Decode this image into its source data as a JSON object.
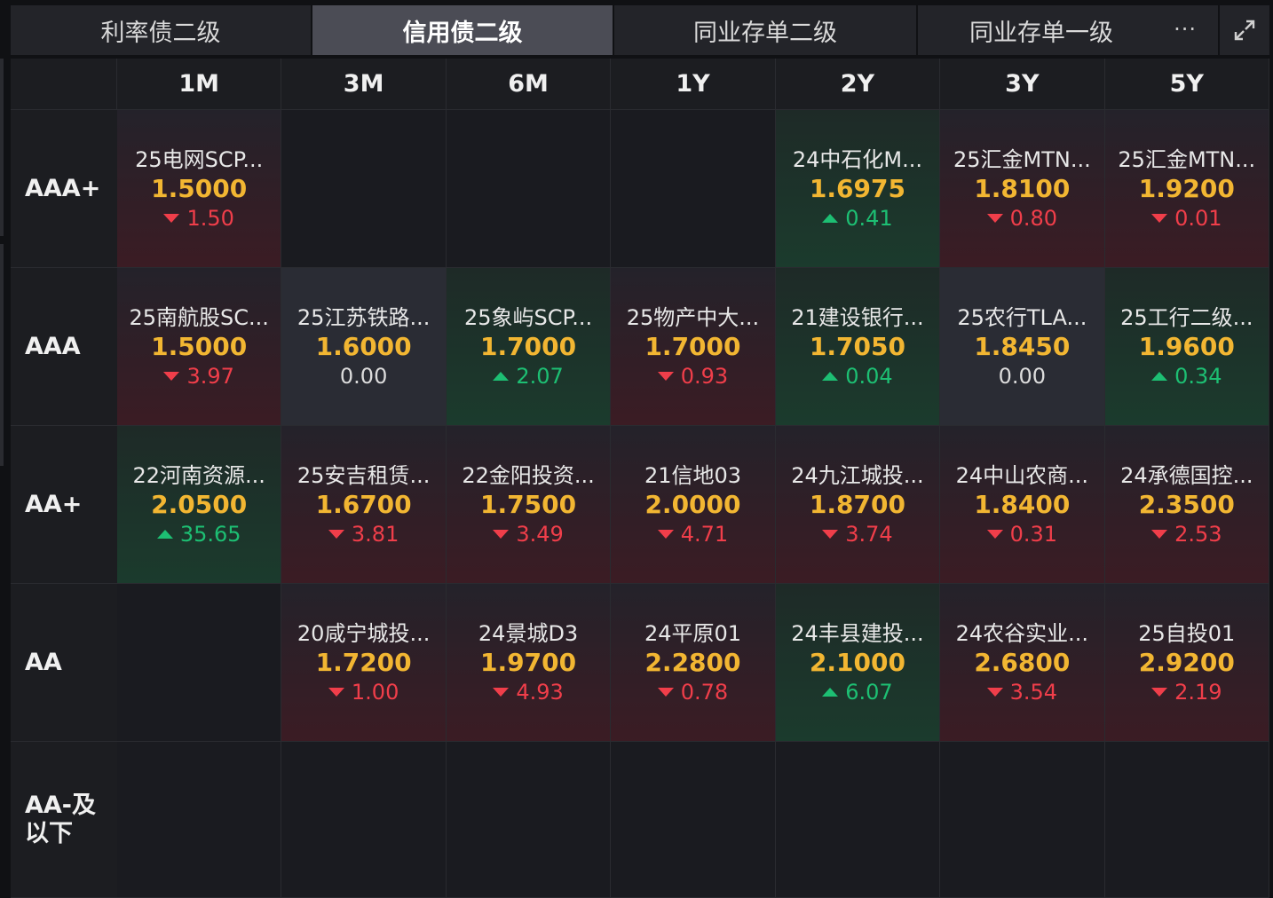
{
  "tabs": [
    {
      "label": "利率债二级",
      "active": false
    },
    {
      "label": "信用债二级",
      "active": true
    },
    {
      "label": "同业存单二级",
      "active": false
    },
    {
      "label": "同业存单一级",
      "active": false
    }
  ],
  "tab_more": "···",
  "columns": [
    "1M",
    "3M",
    "6M",
    "1Y",
    "2Y",
    "3Y",
    "5Y"
  ],
  "rows": [
    {
      "label": "AAA+",
      "cells": [
        {
          "name": "25电网SCP...",
          "value": "1.5000",
          "change": "1.50",
          "dir": "down"
        },
        null,
        null,
        null,
        {
          "name": "24中石化M...",
          "value": "1.6975",
          "change": "0.41",
          "dir": "up"
        },
        {
          "name": "25汇金MTN...",
          "value": "1.8100",
          "change": "0.80",
          "dir": "down"
        },
        {
          "name": "25汇金MTN...",
          "value": "1.9200",
          "change": "0.01",
          "dir": "down"
        }
      ]
    },
    {
      "label": "AAA",
      "cells": [
        {
          "name": "25南航股SC...",
          "value": "1.5000",
          "change": "3.97",
          "dir": "down"
        },
        {
          "name": "25江苏铁路...",
          "value": "1.6000",
          "change": "0.00",
          "dir": "flat"
        },
        {
          "name": "25象屿SCP...",
          "value": "1.7000",
          "change": "2.07",
          "dir": "up"
        },
        {
          "name": "25物产中大...",
          "value": "1.7000",
          "change": "0.93",
          "dir": "down"
        },
        {
          "name": "21建设银行...",
          "value": "1.7050",
          "change": "0.04",
          "dir": "up"
        },
        {
          "name": "25农行TLA...",
          "value": "1.8450",
          "change": "0.00",
          "dir": "flat"
        },
        {
          "name": "25工行二级...",
          "value": "1.9600",
          "change": "0.34",
          "dir": "up"
        }
      ]
    },
    {
      "label": "AA+",
      "cells": [
        {
          "name": "22河南资源...",
          "value": "2.0500",
          "change": "35.65",
          "dir": "up"
        },
        {
          "name": "25安吉租赁...",
          "value": "1.6700",
          "change": "3.81",
          "dir": "down"
        },
        {
          "name": "22金阳投资...",
          "value": "1.7500",
          "change": "3.49",
          "dir": "down"
        },
        {
          "name": "21信地03",
          "value": "2.0000",
          "change": "4.71",
          "dir": "down"
        },
        {
          "name": "24九江城投...",
          "value": "1.8700",
          "change": "3.74",
          "dir": "down"
        },
        {
          "name": "24中山农商...",
          "value": "1.8400",
          "change": "0.31",
          "dir": "down"
        },
        {
          "name": "24承德国控...",
          "value": "2.3500",
          "change": "2.53",
          "dir": "down"
        }
      ]
    },
    {
      "label": "AA",
      "cells": [
        null,
        {
          "name": "20咸宁城投...",
          "value": "1.7200",
          "change": "1.00",
          "dir": "down"
        },
        {
          "name": "24景城D3",
          "value": "1.9700",
          "change": "4.93",
          "dir": "down"
        },
        {
          "name": "24平原01",
          "value": "2.2800",
          "change": "0.78",
          "dir": "down"
        },
        {
          "name": "24丰县建投...",
          "value": "2.1000",
          "change": "6.07",
          "dir": "up"
        },
        {
          "name": "24农谷实业...",
          "value": "2.6800",
          "change": "3.54",
          "dir": "down"
        },
        {
          "name": "25自投01",
          "value": "2.9200",
          "change": "2.19",
          "dir": "down"
        }
      ]
    },
    {
      "label": "AA-及以下",
      "cells": [
        null,
        null,
        null,
        null,
        null,
        null,
        null
      ]
    }
  ],
  "colors": {
    "value": "#f2b632",
    "down": "#f03e4a",
    "up": "#1dbf73",
    "active_tab": "#4b4c55"
  }
}
